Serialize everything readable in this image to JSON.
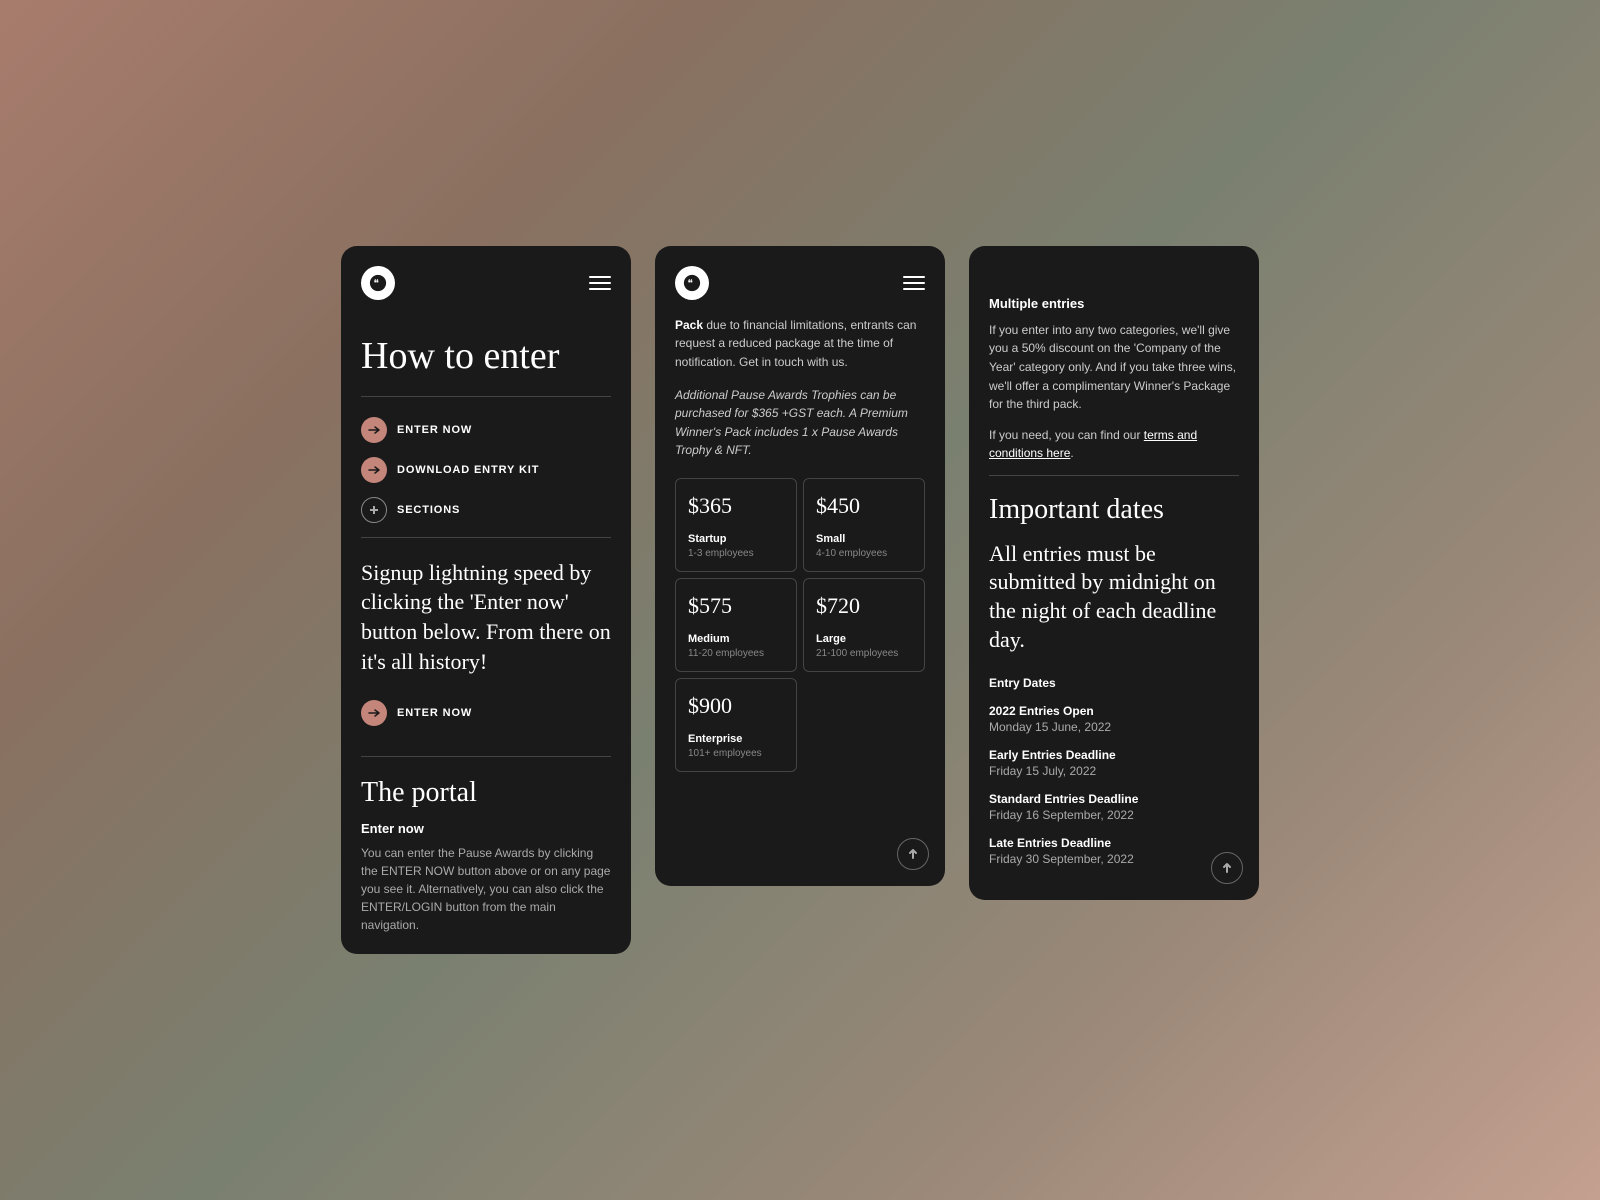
{
  "background": "#1a1a1a",
  "accent_color": "#c4857a",
  "panel1": {
    "logo_alt": "Pause Awards Logo",
    "page_title": "How to enter",
    "nav_items": [
      {
        "label": "ENTER NOW",
        "type": "arrow"
      },
      {
        "label": "DOWNLOAD ENTRY KIT",
        "type": "arrow"
      },
      {
        "label": "SECTIONS",
        "type": "plus"
      }
    ],
    "signup_text": "Signup lightning speed by clicking the 'Enter now' button below. From there on it's all history!",
    "enter_now_label": "ENTER NOW",
    "divider": true,
    "portal_section": {
      "title": "The portal",
      "enter_now_subtitle": "Enter now",
      "portal_text": "You can enter the Pause Awards by clicking the ENTER NOW button above or on any page you see it. Alternatively, you can also click the ENTER/LOGIN button from the main navigation."
    }
  },
  "panel2": {
    "pack_text_bold": "Pack",
    "pack_text_rest": " due to financial limitations, entrants can request a reduced package at the time of notification. Get in touch with us.",
    "pack_italic": "Additional Pause Awards Trophies can be purchased for $365 +GST each. A Premium Winner's Pack includes 1 x Pause Awards Trophy & NFT.",
    "pricing": [
      {
        "amount": "$365",
        "tier": "Startup",
        "employees": "1-3 employees"
      },
      {
        "amount": "$450",
        "tier": "Small",
        "employees": "4-10 employees"
      },
      {
        "amount": "$575",
        "tier": "Medium",
        "employees": "11-20 employees"
      },
      {
        "amount": "$720",
        "tier": "Large",
        "employees": "21-100 employees"
      },
      {
        "amount": "$900",
        "tier": "Enterprise",
        "employees": "101+ employees"
      }
    ]
  },
  "panel3": {
    "multiple_entries_title": "Multiple entries",
    "multiple_entries_text1": "If you enter into any two categories, we'll give you a 50% discount on the 'Company of the Year' category only. And if you take three wins, we'll offer a complimentary Winner's Package for the third pack.",
    "multiple_entries_text2": "If you need, you can find our",
    "tc_link_text": "terms and conditions here",
    "tc_period": ".",
    "important_dates_title": "Important dates",
    "all_entries_text": "All entries must be submitted by midnight on the night of each deadline day.",
    "entry_dates_label": "Entry Dates",
    "dates": [
      {
        "title": "2022 Entries Open",
        "value": "Monday 15 June, 2022"
      },
      {
        "title": "Early Entries Deadline",
        "value": "Friday 15 July, 2022"
      },
      {
        "title": "Standard Entries Deadline",
        "value": "Friday 16 September, 2022"
      },
      {
        "title": "Late Entries Deadline",
        "value": "Friday 30 September, 2022"
      }
    ]
  }
}
